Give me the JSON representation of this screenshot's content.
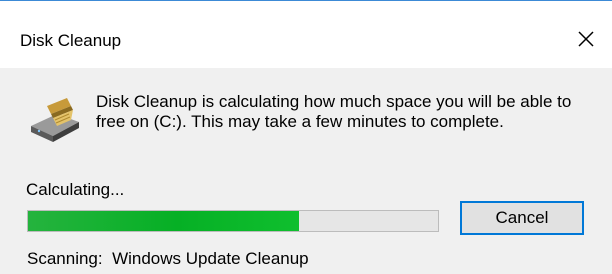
{
  "window": {
    "title": "Disk Cleanup",
    "accent_color": "#0078d7"
  },
  "icons": {
    "close": "close-icon",
    "disk": "disk-cleanup-icon"
  },
  "message": "Disk Cleanup is calculating how much space you will be able to free on  (C:). This may take a few minutes to complete.",
  "status_label": "Calculating...",
  "progress": {
    "fraction": 0.66,
    "color": "#06b025"
  },
  "cancel_label": "Cancel",
  "scanning": {
    "prefix": "Scanning:",
    "item": "Windows Update Cleanup"
  }
}
